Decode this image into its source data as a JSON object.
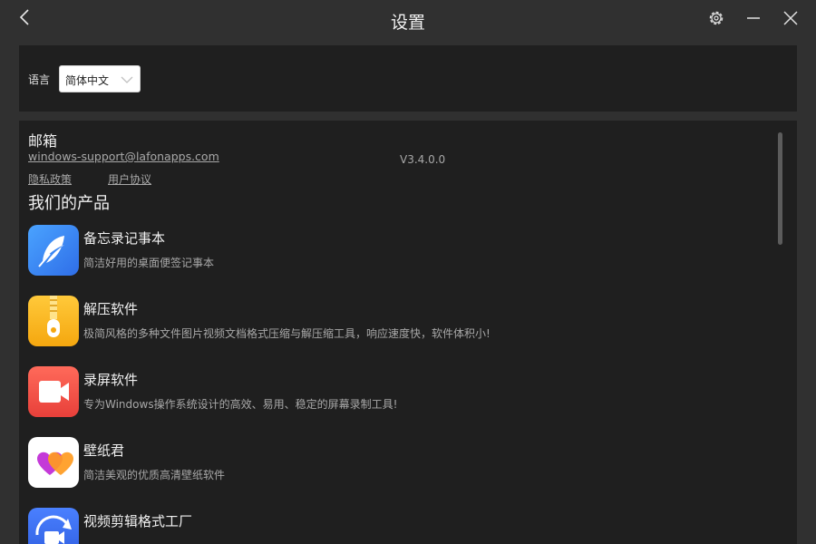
{
  "window": {
    "title": "设置"
  },
  "language": {
    "label": "语言",
    "selected": "简体中文"
  },
  "info": {
    "email_title": "邮箱",
    "email": "windows-support@lafonapps.com",
    "version": "V3.4.0.0",
    "privacy": "隐私政策",
    "agreement": "用户协议",
    "products_title": "我们的产品"
  },
  "products": [
    {
      "name": "备忘录记事本",
      "desc": "简洁好用的桌面便签记事本",
      "icon": "feather-icon",
      "color": "#3b8cf5"
    },
    {
      "name": "解压软件",
      "desc": "极简风格的多种文件图片视频文档格式压缩与解压缩工具，响应速度快，软件体积小!",
      "icon": "zipper-icon",
      "color": "#f5b820"
    },
    {
      "name": "录屏软件",
      "desc": "专为Windows操作系统设计的高效、易用、稳定的屏幕录制工具!",
      "icon": "video-camera-icon",
      "color": "#f2504a"
    },
    {
      "name": "壁纸君",
      "desc": "简洁美观的优质高清壁纸软件",
      "icon": "hearts-icon",
      "color": "#ffffff"
    },
    {
      "name": "视频剪辑格式工厂",
      "desc": "",
      "icon": "video-convert-icon",
      "color": "#3a6ff0"
    }
  ]
}
